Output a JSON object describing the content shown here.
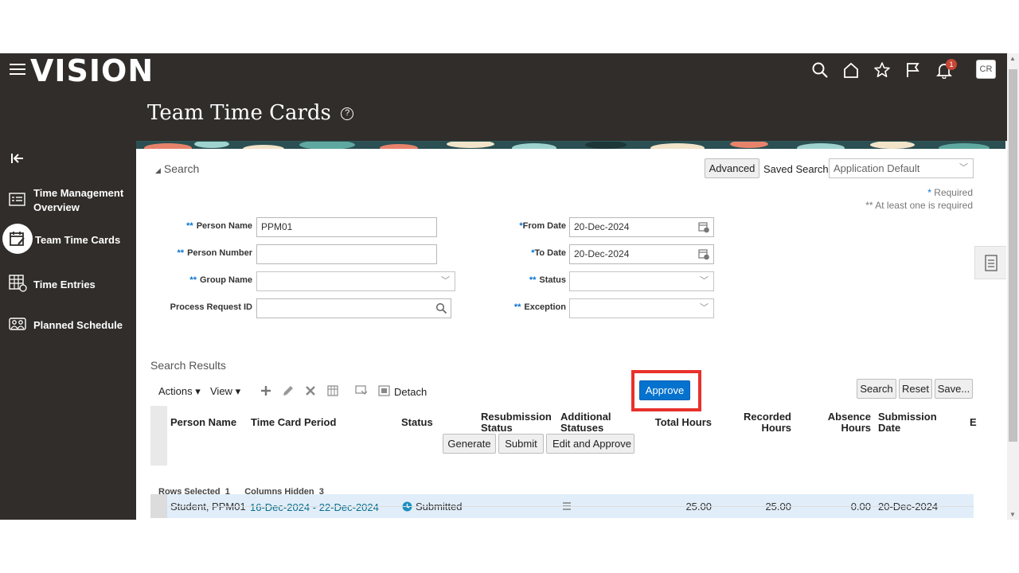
{
  "header": {
    "brand": "VISION",
    "page_title": "Team Time Cards",
    "help_glyph": "?",
    "notification_count": "1",
    "user_initials": "CR",
    "icons": [
      "search-icon",
      "home-icon",
      "star-icon",
      "flag-icon",
      "bell-icon"
    ]
  },
  "sidebar": {
    "items": [
      {
        "label": "Time Management Overview",
        "icon": "overview-icon"
      },
      {
        "label": "Team Time Cards",
        "icon": "team-time-cards-icon",
        "active": true
      },
      {
        "label": "Time Entries",
        "icon": "time-entries-icon"
      },
      {
        "label": "Planned Schedule",
        "icon": "planned-schedule-icon"
      }
    ]
  },
  "search": {
    "header": "Search",
    "advanced_label": "Advanced",
    "saved_search_label": "Saved Search",
    "saved_search_value": "Application Default",
    "required_note": "Required",
    "required_mark": "*",
    "at_least_one_note": "** At least one is required",
    "fields": {
      "person_name": {
        "label": "Person Name",
        "value": "PPM01",
        "mark": "**"
      },
      "person_number": {
        "label": "Person Number",
        "value": "",
        "mark": "**"
      },
      "group_name": {
        "label": "Group Name",
        "value": "",
        "mark": "**"
      },
      "process_request_id": {
        "label": "Process Request ID",
        "value": ""
      },
      "from_date": {
        "label": "From Date",
        "value": "20-Dec-2024",
        "mark": "*"
      },
      "to_date": {
        "label": "To Date",
        "value": "20-Dec-2024",
        "mark": "*"
      },
      "status": {
        "label": "Status",
        "value": "",
        "mark": "**"
      },
      "exception": {
        "label": "Exception",
        "value": "",
        "mark": "**"
      }
    },
    "buttons": {
      "search": "Search",
      "reset": "Reset",
      "save": "Save..."
    }
  },
  "results": {
    "title": "Search Results",
    "toolbar": {
      "actions": "Actions",
      "view": "View",
      "detach": "Detach",
      "generate": "Generate",
      "submit": "Submit",
      "edit_and_approve": "Edit and Approve",
      "approve": "Approve"
    },
    "columns": {
      "person_name": "Person Name",
      "period": "Time Card Period",
      "status": "Status",
      "resubmission_1": "Resubmission",
      "resubmission_2": "Status",
      "additional_1": "Additional",
      "additional_2": "Statuses",
      "total_hours": "Total Hours",
      "recorded_1": "Recorded",
      "recorded_2": "Hours",
      "absence_1": "Absence",
      "absence_2": "Hours",
      "submission_1": "Submission",
      "submission_2": "Date",
      "overflow": "E"
    },
    "rows": [
      {
        "person_name": "Student, PPM01",
        "period": "16-Dec-2024 - 22-Dec-2024",
        "status": "Submitted",
        "total_hours": "25.00",
        "recorded_hours": "25.00",
        "absence_hours": "0.00",
        "submission_date": "20-Dec-2024"
      }
    ],
    "footer": {
      "rows_selected_label": "Rows Selected",
      "rows_selected_value": "1",
      "columns_hidden_label": "Columns Hidden",
      "columns_hidden_value": "3"
    }
  },
  "colors": {
    "accent": "#0572ce",
    "highlight": "#e8312b",
    "chrome": "#302d2a"
  }
}
